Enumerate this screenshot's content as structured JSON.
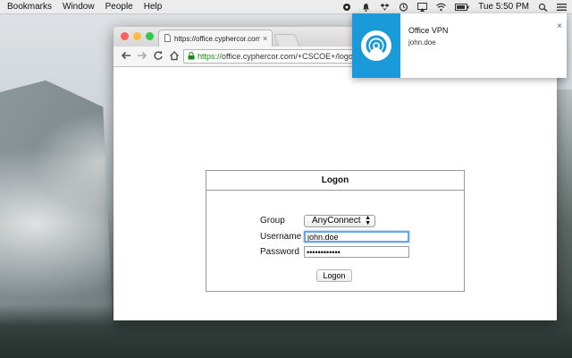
{
  "menubar": {
    "items": [
      "Bookmarks",
      "Window",
      "People",
      "Help"
    ],
    "battery_label": "",
    "clock": "Tue 5:50 PM"
  },
  "browser": {
    "tab_title": "https://office.cyphercor.com",
    "tab_close": "×",
    "url_https": "https://",
    "url_rest": "office.cyphercor.com/+CSCOE+/logon.html"
  },
  "logon": {
    "title": "Logon",
    "group_label": "Group",
    "group_value": "AnyConnect",
    "username_label": "Username",
    "username_value": "john.doe",
    "password_label": "Password",
    "password_value": "••••••••••••",
    "button_label": "Logon"
  },
  "notification": {
    "title": "Office VPN",
    "body": "john.doe",
    "close": "×",
    "accent": "#1a9ad9"
  }
}
